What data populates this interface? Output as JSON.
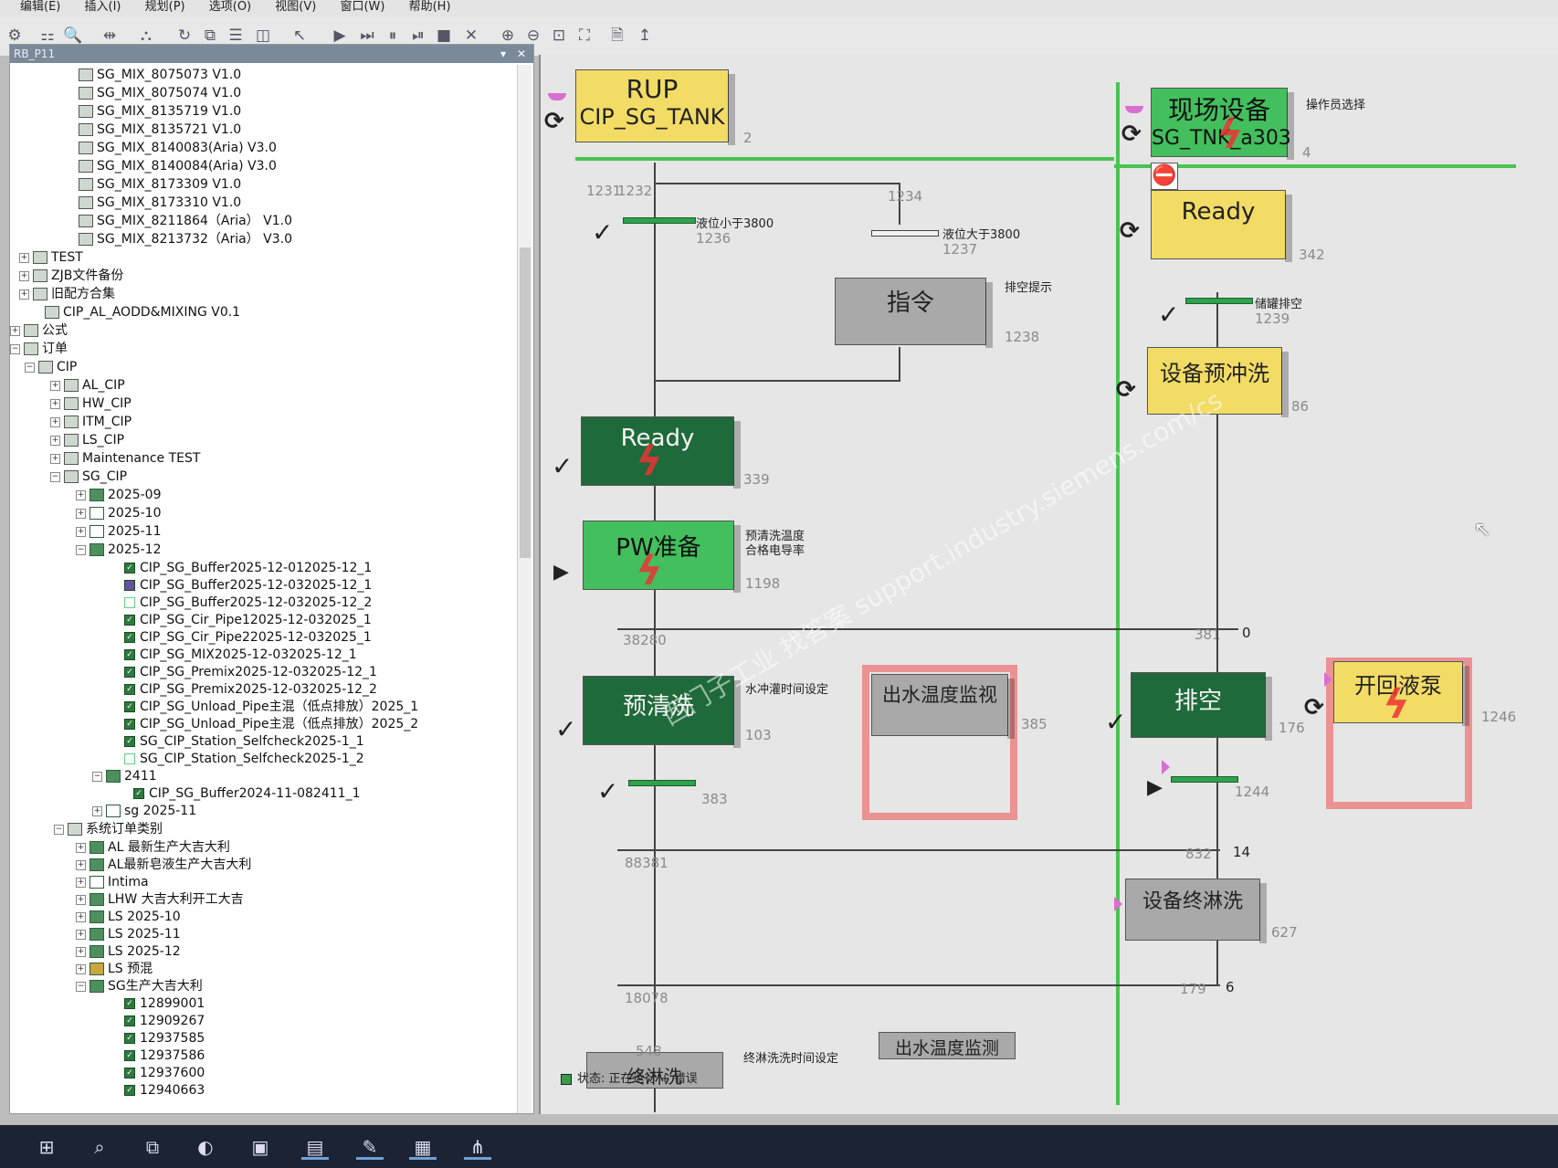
{
  "menubar": {
    "items": [
      "编辑(E)",
      "插入(I)",
      "规划(P)",
      "选项(O)",
      "视图(V)",
      "窗口(W)",
      "帮助(H)"
    ]
  },
  "tree": {
    "title": "RB_P11",
    "nodes": [
      "SG_MIX_8075073 V1.0",
      "SG_MIX_8075074 V1.0",
      "SG_MIX_8135719 V1.0",
      "SG_MIX_8135721 V1.0",
      "SG_MIX_8140083(Aria)  V3.0",
      "SG_MIX_8140084(Aria)  V3.0",
      "SG_MIX_8173309 V1.0",
      "SG_MIX_8173310 V1.0",
      "SG_MIX_8211864（Aria） V1.0",
      "SG_MIX_8213732（Aria） V3.0",
      "TEST",
      "ZJB文件备份",
      "旧配方合集",
      "CIP_AL_AODD&MIXING V0.1",
      "公式",
      "订单",
      "CIP",
      "AL_CIP",
      "HW_CIP",
      "ITM_CIP",
      "LS_CIP",
      "Maintenance TEST",
      "SG_CIP",
      "2025-09",
      "2025-10",
      "2025-11",
      "2025-12",
      "CIP_SG_Buffer2025-12-012025-12_1",
      "CIP_SG_Buffer2025-12-032025-12_1",
      "CIP_SG_Buffer2025-12-032025-12_2",
      "CIP_SG_Cir_Pipe12025-12-032025_1",
      "CIP_SG_Cir_Pipe22025-12-032025_1",
      "CIP_SG_MIX2025-12-032025-12_1",
      "CIP_SG_Premix2025-12-032025-12_1",
      "CIP_SG_Premix2025-12-032025-12_2",
      "CIP_SG_Unload_Pipe主混（低点排放）2025_1",
      "CIP_SG_Unload_Pipe主混（低点排放）2025_2",
      "SG_CIP_Station_Selfcheck2025-1_1",
      "SG_CIP_Station_Selfcheck2025-1_2",
      "2411",
      "CIP_SG_Buffer2024-11-082411_1",
      "sg 2025-11",
      "系统订单类别",
      "AL 最新生产大吉大利",
      "AL最新皂液生产大吉大利",
      "Intima",
      "LHW 大吉大利开工大吉",
      "LS 2025-10",
      "LS 2025-11",
      "LS 2025-12",
      "LS 预混",
      "SG生产大吉大利",
      "12899001",
      "12909267",
      "12937585",
      "12937586",
      "12937600",
      "12940663"
    ]
  },
  "chart": {
    "steps": {
      "rup_title": "RUP",
      "rup_sub": "CIP_SG_TANK",
      "rup_num": "2",
      "xc_title": "现场设备",
      "xc_sub": "SG_TNK_a303",
      "xc_num": "4",
      "xc_note": "操作员选择",
      "ready_right": "Ready",
      "ready_right_num": "342",
      "cmd": "指令",
      "cmd_note": "排空提示",
      "cmd_num": "1238",
      "preflush": "设备预冲洗",
      "preflush_num": "86",
      "ready_left": "Ready",
      "ready_left_num": "339",
      "pw": "PW准备",
      "pw_note1": "预清洗温度",
      "pw_note2": "合格电导率",
      "pw_num": "1198",
      "prewash": "预清洗",
      "prewash_note": "水冲灌时间设定",
      "prewash_num": "103",
      "outtemp": "出水温度监视",
      "outtemp_num": "385",
      "drain": "排空",
      "drain_num": "176",
      "pump": "开回液泵",
      "pump_num": "1246",
      "final": "设备终淋洗",
      "final_num": "627",
      "final_left": "终淋洗",
      "final_left_num": "548",
      "final_left_note": "终淋洗洗时间设定",
      "outtemp2": "出水温度监测"
    },
    "transitions": {
      "t1231": "1231",
      "t1232": "1232",
      "t1234": "1234",
      "t1236": "1236",
      "t1236_note": "液位小于3800",
      "t1237": "1237",
      "t1237_note": "液位大于3800",
      "t1239": "1239",
      "t1239_note": "储罐排空",
      "j1_left": "38280",
      "j1_right": "381",
      "j1_right2": "0",
      "t383": "383",
      "t1244": "1244",
      "j2_left": "88381",
      "j2_right": "832",
      "j2_right2": "14",
      "j3_left": "18078",
      "j3_right": "179",
      "j3_right2": "6"
    }
  },
  "status": {
    "text": "状态: 正在运行 + 错误"
  },
  "watermark": {
    "text": "西门子工业 找答案 support.industry.siemens.com/cs"
  }
}
